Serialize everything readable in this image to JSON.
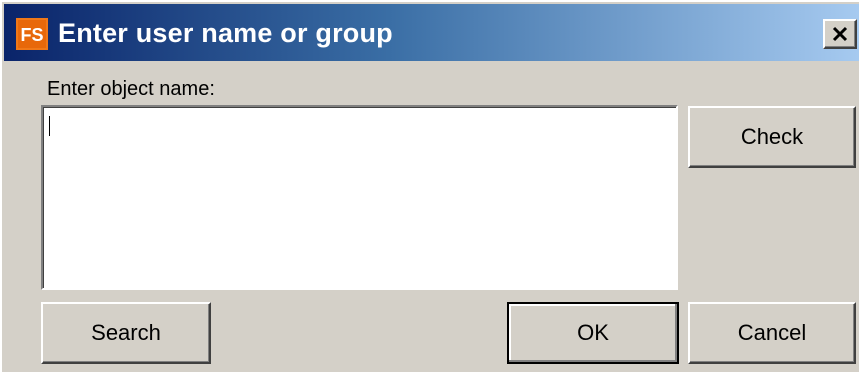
{
  "window": {
    "title": "Enter user name or group",
    "icon": "fs-app-icon",
    "close_icon": "close-icon"
  },
  "form": {
    "label": "Enter object name:",
    "object_name_value": ""
  },
  "buttons": {
    "check": "Check",
    "search": "Search",
    "ok": "OK",
    "cancel": "Cancel"
  },
  "colors": {
    "titlebar_start": "#0a246a",
    "titlebar_end": "#a6caf0",
    "dialog_bg": "#d4d0c8",
    "icon_orange": "#f07818"
  }
}
